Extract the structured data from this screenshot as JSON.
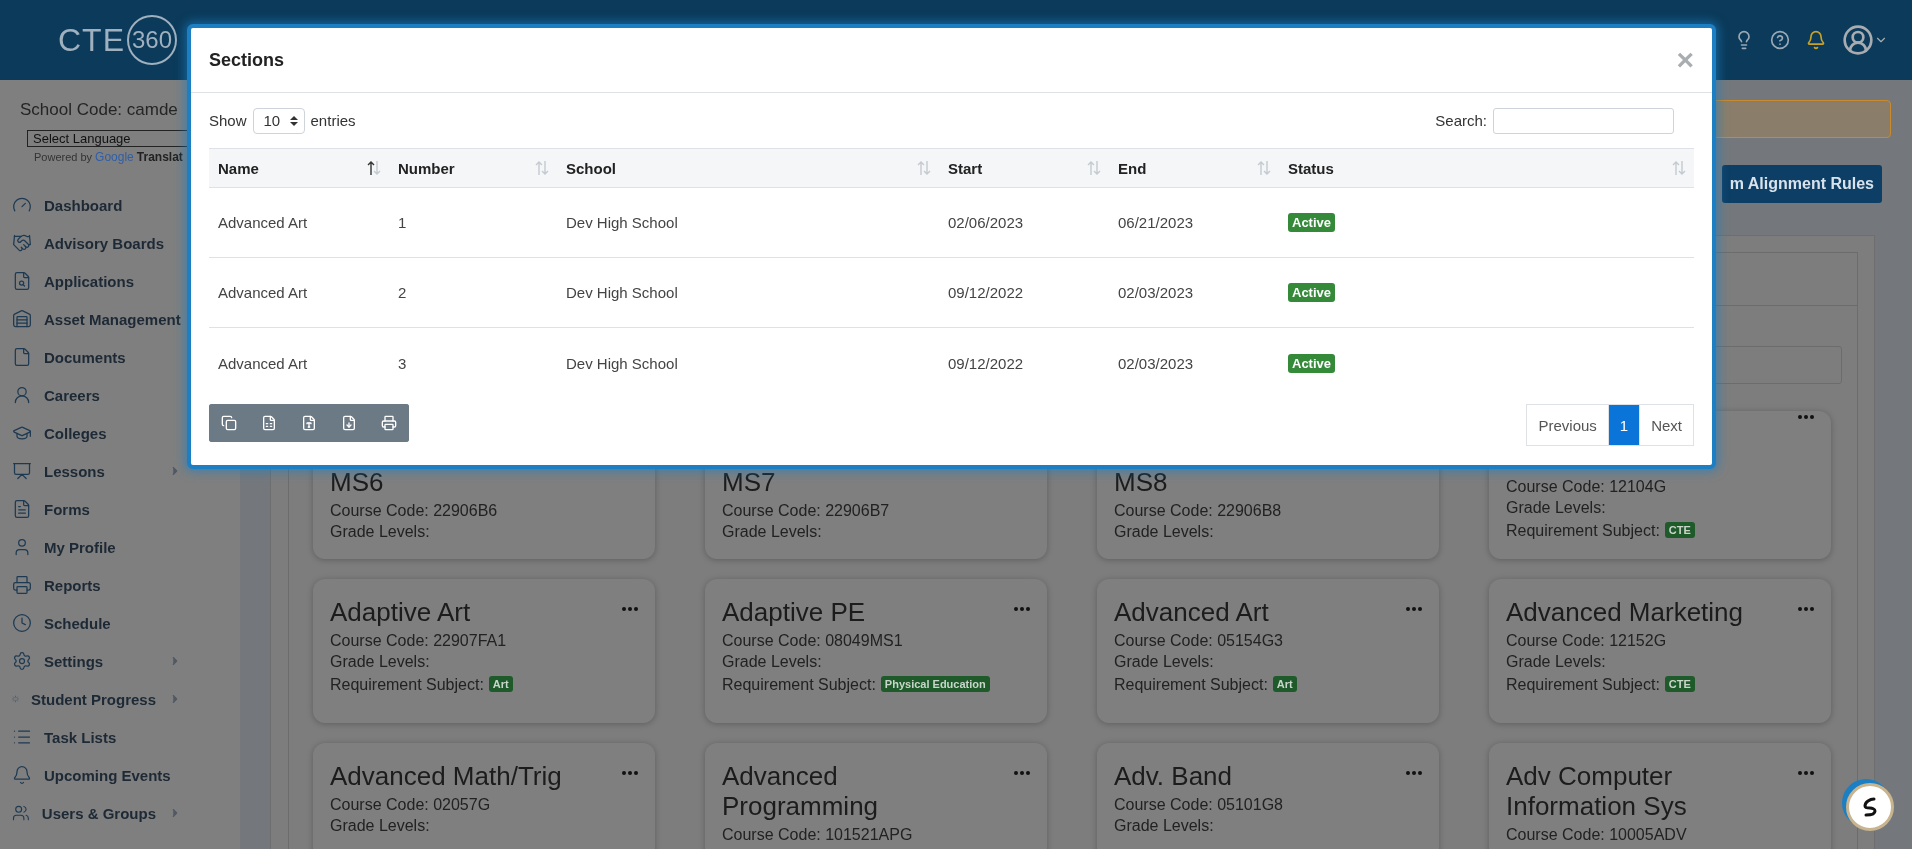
{
  "header": {
    "logo_text": "CTE",
    "logo_ring": "360"
  },
  "sidebar": {
    "school_code": "School Code: camde",
    "language_select": "Select Language",
    "powered_by": "Powered by",
    "google": "Google",
    "translate": "Translat",
    "items": [
      {
        "label": "Dashboard",
        "expandable": false
      },
      {
        "label": "Advisory Boards",
        "expandable": false
      },
      {
        "label": "Applications",
        "expandable": false
      },
      {
        "label": "Asset Management",
        "expandable": false
      },
      {
        "label": "Documents",
        "expandable": false
      },
      {
        "label": "Careers",
        "expandable": false
      },
      {
        "label": "Colleges",
        "expandable": false
      },
      {
        "label": "Lessons",
        "expandable": true
      },
      {
        "label": "Forms",
        "expandable": false
      },
      {
        "label": "My Profile",
        "expandable": false
      },
      {
        "label": "Reports",
        "expandable": false
      },
      {
        "label": "Schedule",
        "expandable": false
      },
      {
        "label": "Settings",
        "expandable": true
      },
      {
        "label": "Student Progress",
        "expandable": true
      },
      {
        "label": "Task Lists",
        "expandable": false
      },
      {
        "label": "Upcoming Events",
        "expandable": false
      },
      {
        "label": "Users & Groups",
        "expandable": true
      }
    ]
  },
  "main": {
    "action_button": "m Alignment Rules",
    "cards": [
      {
        "title": "MS6",
        "course_code": "Course Code: 22906B6",
        "grade_levels": "Grade Levels:",
        "menu": false
      },
      {
        "title": "MS7",
        "course_code": "Course Code: 22906B7",
        "grade_levels": "Grade Levels:",
        "menu": false
      },
      {
        "title": "MS8",
        "course_code": "Course Code: 22906B8",
        "grade_levels": "Grade Levels:",
        "menu": false
      },
      {
        "course_code": "Course Code: 12104G",
        "grade_levels": "Grade Levels:",
        "requirement": "Requirement Subject:",
        "subject": "CTE",
        "menu": true
      },
      {
        "title": "Adaptive Art",
        "course_code": "Course Code: 22907FA1",
        "grade_levels": "Grade Levels:",
        "requirement": "Requirement Subject:",
        "subject": "Art",
        "menu": true
      },
      {
        "title": "Adaptive PE",
        "course_code": "Course Code: 08049MS1",
        "grade_levels": "Grade Levels:",
        "requirement": "Requirement Subject:",
        "subject": "Physical Education",
        "menu": true
      },
      {
        "title": "Advanced Art",
        "course_code": "Course Code: 05154G3",
        "grade_levels": "Grade Levels:",
        "requirement": "Requirement Subject:",
        "subject": "Art",
        "menu": true
      },
      {
        "title": "Advanced Marketing",
        "course_code": "Course Code: 12152G",
        "grade_levels": "Grade Levels:",
        "requirement": "Requirement Subject:",
        "subject": "CTE",
        "menu": true
      },
      {
        "title": "Advanced Math/Trig",
        "course_code": "Course Code: 02057G",
        "grade_levels": "Grade Levels:",
        "menu": true
      },
      {
        "title": "Advanced Programming",
        "course_code": "Course Code: 101521APG",
        "menu": true
      },
      {
        "title": "Adv. Band",
        "course_code": "Course Code: 05101G8",
        "grade_levels": "Grade Levels:",
        "menu": true
      },
      {
        "title": "Adv Computer Information Sys",
        "course_code": "Course Code: 10005ADV",
        "menu": true
      }
    ]
  },
  "modal": {
    "title": "Sections",
    "close": "×",
    "show_label": "Show",
    "page_size": "10",
    "entries_label": "entries",
    "search_label": "Search:",
    "columns": [
      {
        "label": "Name",
        "sorted": true
      },
      {
        "label": "Number",
        "sorted": false
      },
      {
        "label": "School",
        "sorted": false
      },
      {
        "label": "Start",
        "sorted": false
      },
      {
        "label": "End",
        "sorted": false
      },
      {
        "label": "Status",
        "sorted": false
      }
    ],
    "rows": [
      {
        "name": "Advanced Art",
        "number": "1",
        "school": "Dev High School",
        "start": "02/06/2023",
        "end": "06/21/2023",
        "status": "Active"
      },
      {
        "name": "Advanced Art",
        "number": "2",
        "school": "Dev High School",
        "start": "09/12/2022",
        "end": "02/03/2023",
        "status": "Active"
      },
      {
        "name": "Advanced Art",
        "number": "3",
        "school": "Dev High School",
        "start": "09/12/2022",
        "end": "02/03/2023",
        "status": "Active"
      }
    ],
    "pagination": {
      "previous": "Previous",
      "pages": [
        {
          "label": "1",
          "selected": true
        }
      ],
      "next": "Next"
    }
  }
}
